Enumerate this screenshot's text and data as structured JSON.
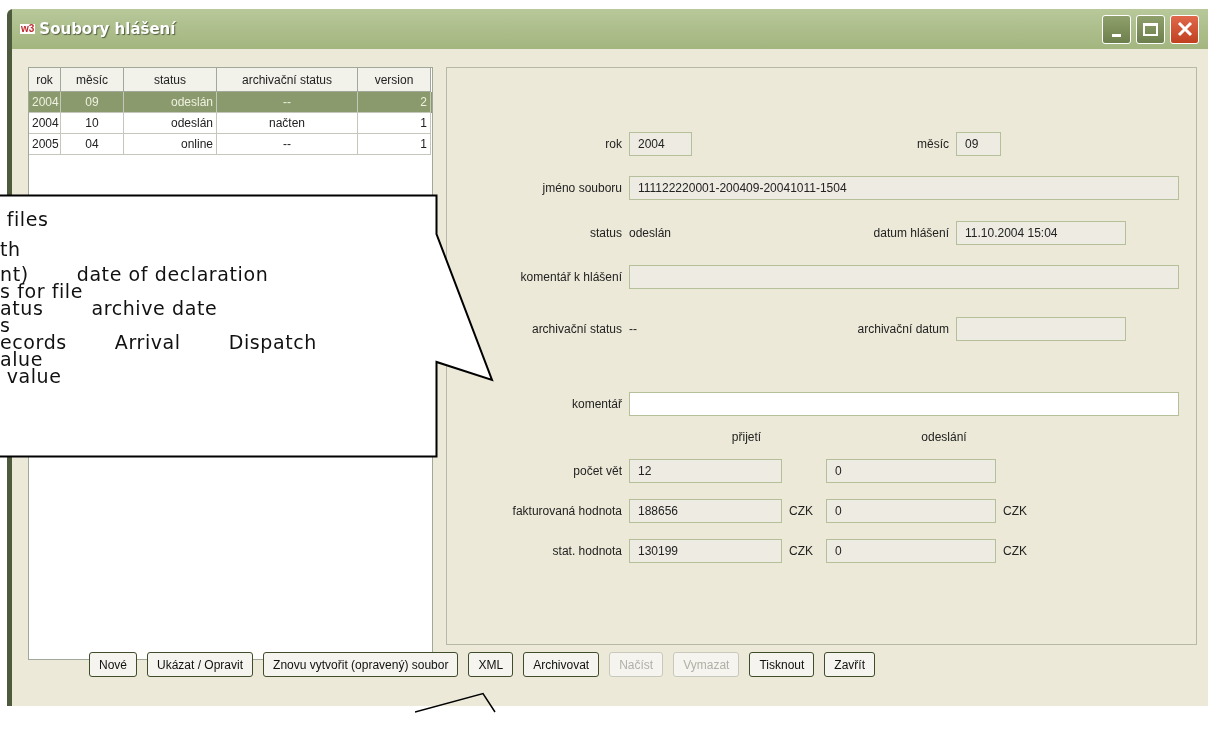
{
  "window": {
    "icon_text": "w3",
    "title": "Soubory hlášení"
  },
  "table": {
    "columns": [
      "rok",
      "měsíc",
      "status",
      "archivační status",
      "version"
    ],
    "rows": [
      {
        "cells": [
          "2004",
          "09",
          "odeslán",
          "--",
          "2"
        ],
        "selected": true
      },
      {
        "cells": [
          "2004",
          "10",
          "odeslán",
          "načten",
          "1"
        ],
        "selected": false
      },
      {
        "cells": [
          "2005",
          "04",
          "online",
          "--",
          "1"
        ],
        "selected": false
      }
    ]
  },
  "detail": {
    "rok": {
      "label": "rok",
      "value": "2004"
    },
    "mesic": {
      "label": "měsíc",
      "value": "09"
    },
    "jmeno": {
      "label": "jméno souboru",
      "value": "111122220001-200409-20041011-1504"
    },
    "status": {
      "label": "status",
      "value": "odeslán"
    },
    "datum": {
      "label": "datum hlášení",
      "value": "11.10.2004 15:04"
    },
    "komentar_hlaseni": {
      "label": "komentář k hlášení"
    },
    "arch_status": {
      "label": "archivační status",
      "value": "--"
    },
    "arch_datum": {
      "label": "archivační datum"
    },
    "komentar": {
      "label": "komentář"
    },
    "col_headers": [
      "přijetí",
      "odeslání"
    ],
    "amount_rows": [
      {
        "label": "počet vět",
        "values": [
          "12",
          "0"
        ]
      },
      {
        "label": "fakturovaná hodnota",
        "values": [
          "188656",
          "0"
        ],
        "units": [
          "CZK",
          "CZK"
        ]
      },
      {
        "label": "stat. hodnota",
        "values": [
          "130199",
          "0"
        ],
        "units": [
          "CZK",
          "CZK"
        ]
      }
    ]
  },
  "buttons": [
    {
      "label": "Nové",
      "disabled": false
    },
    {
      "label": "Ukázat / Opravit",
      "disabled": false
    },
    {
      "label": "Znovu vytvořit (opravený) soubor",
      "disabled": false
    },
    {
      "label": "XML",
      "disabled": false
    },
    {
      "label": "Archivovat",
      "disabled": false
    },
    {
      "label": "Načíst",
      "disabled": true
    },
    {
      "label": "Vymazat",
      "disabled": true
    },
    {
      "label": "Tisknout",
      "disabled": false
    },
    {
      "label": "Zavřít",
      "disabled": false
    }
  ],
  "callout": {
    "lines": [
      [
        " files"
      ],
      [
        "th"
      ],
      [
        "nt)",
        "date of declaration"
      ],
      [
        "s for file"
      ],
      [
        "atus",
        "archive date"
      ],
      [
        "s"
      ],
      [
        "ecords",
        "Arrival",
        "Dispatch"
      ],
      [
        "alue"
      ],
      [
        " value"
      ]
    ]
  }
}
